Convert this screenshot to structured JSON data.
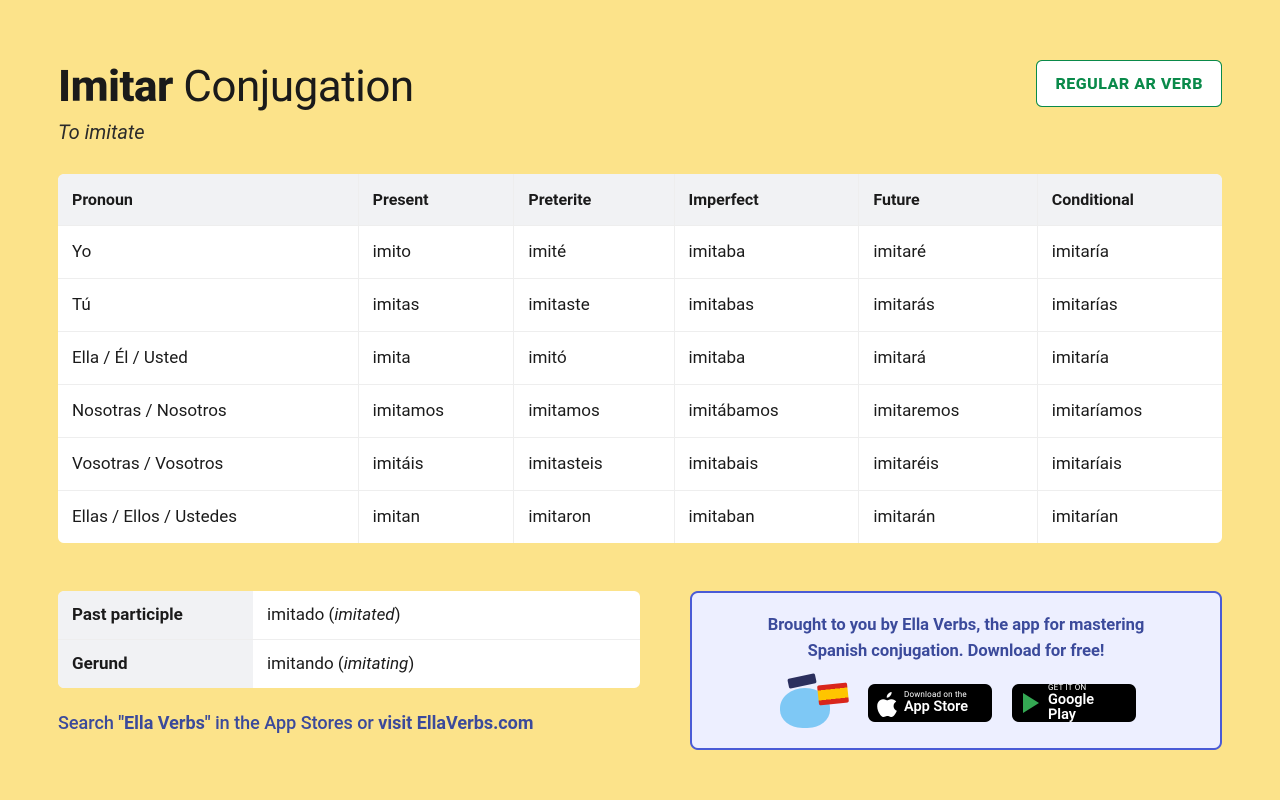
{
  "header": {
    "verb": "Imitar",
    "title_suffix": "Conjugation",
    "subtitle": "To imitate",
    "badge": "REGULAR AR VERB"
  },
  "table": {
    "headers": [
      "Pronoun",
      "Present",
      "Preterite",
      "Imperfect",
      "Future",
      "Conditional"
    ],
    "rows": [
      [
        "Yo",
        "imito",
        "imité",
        "imitaba",
        "imitaré",
        "imitaría"
      ],
      [
        "Tú",
        "imitas",
        "imitaste",
        "imitabas",
        "imitarás",
        "imitarías"
      ],
      [
        "Ella / Él / Usted",
        "imita",
        "imitó",
        "imitaba",
        "imitará",
        "imitaría"
      ],
      [
        "Nosotras / Nosotros",
        "imitamos",
        "imitamos",
        "imitábamos",
        "imitaremos",
        "imitaríamos"
      ],
      [
        "Vosotras / Vosotros",
        "imitáis",
        "imitasteis",
        "imitabais",
        "imitaréis",
        "imitaríais"
      ],
      [
        "Ellas / Ellos / Ustedes",
        "imitan",
        "imitaron",
        "imitaban",
        "imitarán",
        "imitarían"
      ]
    ]
  },
  "forms": {
    "past_participle_label": "Past participle",
    "past_participle_value": "imitado",
    "past_participle_trans": "imitated",
    "gerund_label": "Gerund",
    "gerund_value": "imitando",
    "gerund_trans": "imitating"
  },
  "search_note": {
    "prefix": "Search ",
    "bold": "\"Ella Verbs\"",
    "mid": " in the App Stores or ",
    "bold2": "visit EllaVerbs.com"
  },
  "promo": {
    "line1": "Brought to you by Ella Verbs, the app for mastering",
    "line2": "Spanish conjugation. Download for free!",
    "app_store_small": "Download on the",
    "app_store_big": "App Store",
    "google_small": "GET IT ON",
    "google_big": "Google Play"
  }
}
